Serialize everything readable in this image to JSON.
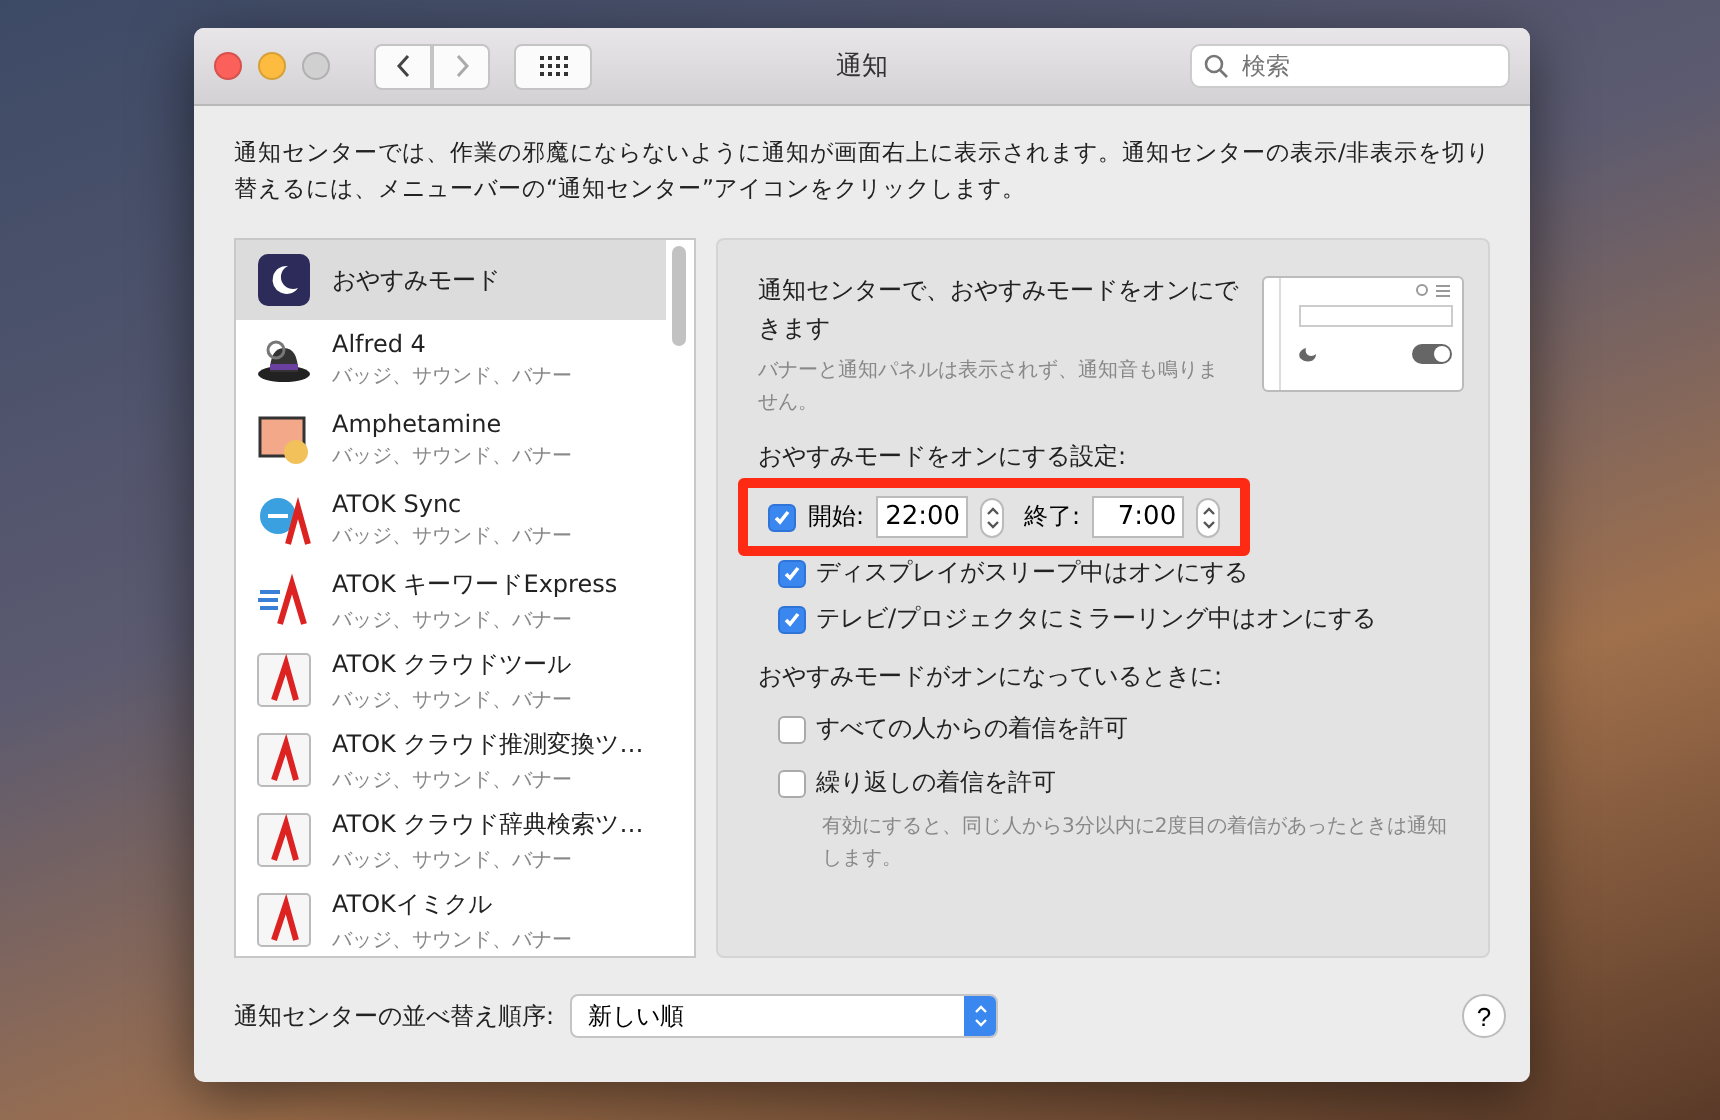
{
  "window": {
    "title": "通知",
    "search": {
      "placeholder": "検索"
    }
  },
  "intro": "通知センターでは、作業の邪魔にならないように通知が画面右上に表示されます。通知センターの表示/非表示を切り替えるには、メニューバーの“通知センター”アイコンをクリックします。",
  "apps": [
    {
      "name": "おやすみモード",
      "kind": "moon",
      "selected": true
    },
    {
      "name": "Alfred 4",
      "detail": "バッジ、サウンド、バナー",
      "kind": "hat",
      "selected": false
    },
    {
      "name": "Amphetamine",
      "detail": "バッジ、サウンド、バナー",
      "kind": "monitor",
      "selected": false
    },
    {
      "name": "ATOK Sync",
      "detail": "バッジ、サウンド、バナー",
      "kind": "sync",
      "selected": false
    },
    {
      "name": "ATOK キーワードExpress",
      "detail": "バッジ、サウンド、バナー",
      "kind": "express",
      "selected": false
    },
    {
      "name": "ATOK クラウドツール",
      "detail": "バッジ、サウンド、バナー",
      "kind": "atok",
      "selected": false
    },
    {
      "name": "ATOK クラウド推測変換ツ…",
      "detail": "バッジ、サウンド、バナー",
      "kind": "atok",
      "selected": false
    },
    {
      "name": "ATOK クラウド辞典検索ツ…",
      "detail": "バッジ、サウンド、バナー",
      "kind": "atok",
      "selected": false
    },
    {
      "name": "ATOKイミクル",
      "detail": "バッジ、サウンド、バナー",
      "kind": "atok",
      "selected": false
    }
  ],
  "panel": {
    "heading": "通知センターで、おやすみモードをオンにできます",
    "note": "バナーと通知パネルは表示されず、通知音も鳴りません。",
    "schedule_label": "おやすみモードをオンにする設定:",
    "schedule": {
      "checked": true,
      "highlighted": true,
      "start_label": "開始:",
      "start": "22:00",
      "end_label": "終了:",
      "end": "7:00"
    },
    "options": [
      {
        "label": "ディスプレイがスリープ中はオンにする",
        "checked": true
      },
      {
        "label": "テレビ/プロジェクタにミラーリング中はオンにする",
        "checked": true
      }
    ],
    "when_on_label": "おやすみモードがオンになっているときに:",
    "when_on": [
      {
        "label": "すべての人からの着信を許可",
        "checked": false
      },
      {
        "label": "繰り返しの着信を許可",
        "checked": false
      }
    ],
    "when_on_note": "有効にすると、同じ人から3分以内に2度目の着信があったときは通知します。"
  },
  "sort": {
    "label": "通知センターの並べ替え順序:",
    "value": "新しい順"
  },
  "help": "?"
}
